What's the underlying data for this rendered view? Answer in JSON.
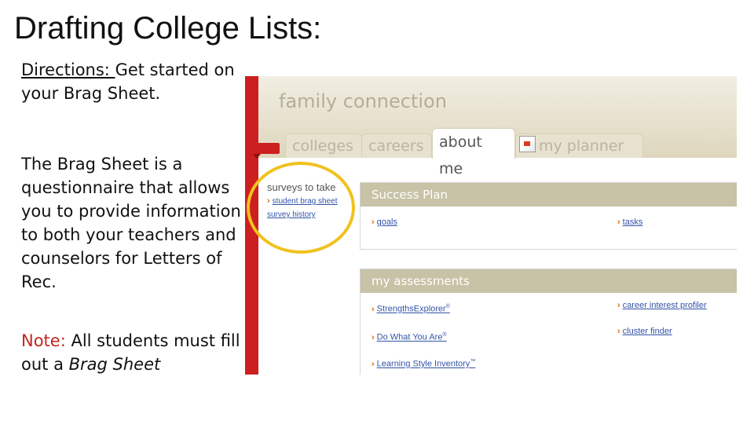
{
  "slide": {
    "title": "Drafting College Lists:",
    "directions_label": "Directions: ",
    "directions_text": "Get started on your Brag Sheet.",
    "body": "The Brag Sheet is a questionnaire that allows you to provide information to both your teachers and counselors for Letters of Rec.",
    "note_label": "Note: ",
    "note_text": "All students must fill out a ",
    "note_emphasis": "Brag Sheet"
  },
  "app": {
    "brand": "family connection",
    "tabs": [
      "colleges",
      "careers",
      "about me",
      "my planner"
    ],
    "active_tab": "about me",
    "sidebar": {
      "title": "surveys to take",
      "links": [
        "student brag sheet",
        "survey history"
      ]
    },
    "success_plan": {
      "title": "Success Plan",
      "links": [
        "goals",
        "tasks"
      ]
    },
    "assessments": {
      "title": "my assessments",
      "links": [
        "StrengthsExplorer",
        "career interest profiler",
        "Do What You Are",
        "cluster finder",
        "Learning Style Inventory"
      ],
      "marks": [
        "®",
        "®",
        "™"
      ]
    }
  },
  "colors": {
    "accent_red": "#cc1f1f",
    "highlight_circle": "#f0c21e",
    "note_label": "#c0281c",
    "link": "#3353a6"
  }
}
